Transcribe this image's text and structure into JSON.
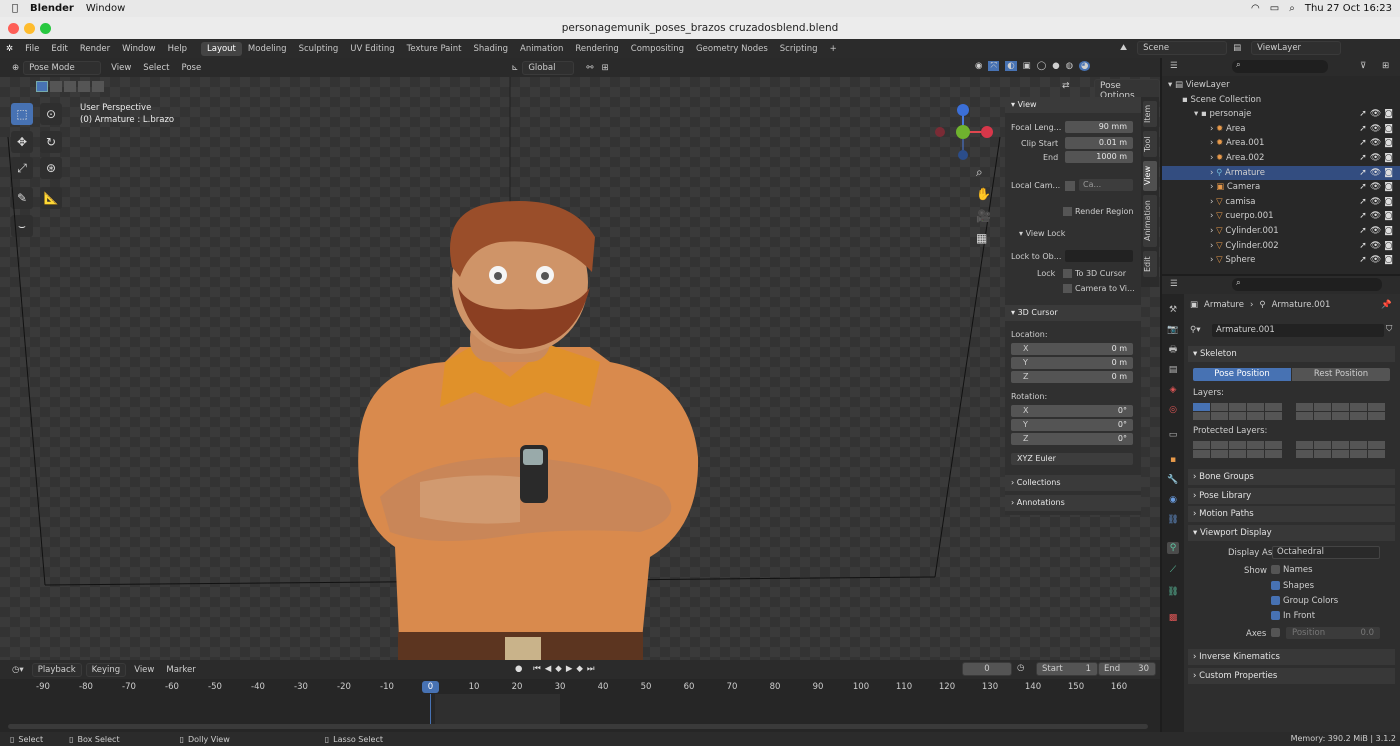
{
  "mac_menu": {
    "app": "Blender",
    "window": "Window",
    "clock": "Thu 27 Oct 16:23"
  },
  "window_title": "personagemunik_poses_brazos cruzadosblend.blend",
  "top_menu": [
    "File",
    "Edit",
    "Render",
    "Window",
    "Help"
  ],
  "workspaces": [
    "Layout",
    "Modeling",
    "Sculpting",
    "UV Editing",
    "Texture Paint",
    "Shading",
    "Animation",
    "Rendering",
    "Compositing",
    "Geometry Nodes",
    "Scripting"
  ],
  "active_workspace": "Layout",
  "scene": {
    "name": "Scene",
    "view_layer": "ViewLayer"
  },
  "viewport_header": {
    "mode": "Pose Mode",
    "menus": [
      "View",
      "Select",
      "Pose"
    ],
    "orientation": "Global",
    "pose_options": "Pose Options"
  },
  "viewport": {
    "perspective": "User Perspective",
    "active": "(0) Armature : L.brazo"
  },
  "npanel": {
    "view_title": "View",
    "focal_label": "Focal Leng...",
    "focal_value": "90 mm",
    "clip_start_label": "Clip Start",
    "clip_start_value": "0.01 m",
    "end_label": "End",
    "end_value": "1000 m",
    "local_cam_label": "Local Cam...",
    "local_cam_value": "Ca...",
    "render_region": "Render Region",
    "view_lock": "View Lock",
    "lock_obj_label": "Lock to Ob...",
    "lock_label": "Lock",
    "to_3d_cursor": "To 3D Cursor",
    "camera_to_view": "Camera to Vi...",
    "cursor_title": "3D Cursor",
    "location_label": "Location:",
    "x_label": "X",
    "y_label": "Y",
    "z_label": "Z",
    "loc_x": "0 m",
    "loc_y": "0 m",
    "loc_z": "0 m",
    "rotation_label": "Rotation:",
    "rot_x": "0°",
    "rot_y": "0°",
    "rot_z": "0°",
    "euler": "XYZ Euler",
    "collections": "Collections",
    "annotations": "Annotations"
  },
  "ntabs": [
    "Item",
    "Tool",
    "View",
    "Animation",
    "Edit"
  ],
  "outliner": {
    "rows": [
      {
        "label": "ViewLayer"
      },
      {
        "label": "Scene Collection"
      },
      {
        "label": "personaje"
      },
      {
        "label": "Area"
      },
      {
        "label": "Area.001"
      },
      {
        "label": "Area.002"
      },
      {
        "label": "Armature"
      },
      {
        "label": "Camera"
      },
      {
        "label": "camisa"
      },
      {
        "label": "cuerpo.001"
      },
      {
        "label": "Cylinder.001"
      },
      {
        "label": "Cylinder.002"
      },
      {
        "label": "Sphere"
      }
    ]
  },
  "properties": {
    "breadcrumb_obj": "Armature",
    "breadcrumb_data": "Armature.001",
    "data_name": "Armature.001",
    "skeleton": "Skeleton",
    "pose_position": "Pose Position",
    "rest_position": "Rest Position",
    "layers": "Layers:",
    "protected_layers": "Protected Layers:",
    "bone_groups": "Bone Groups",
    "pose_library": "Pose Library",
    "motion_paths": "Motion Paths",
    "viewport_display": "Viewport Display",
    "display_as_label": "Display As",
    "display_as_value": "Octahedral",
    "show_label": "Show",
    "names": "Names",
    "shapes": "Shapes",
    "group_colors": "Group Colors",
    "in_front": "In Front",
    "axes_label": "Axes",
    "position": "Position",
    "position_value": "0.0",
    "inverse_kinematics": "Inverse Kinematics",
    "custom_properties": "Custom Properties"
  },
  "timeline": {
    "menus": [
      "Playback",
      "Keying",
      "View",
      "Marker"
    ],
    "current_frame": "0",
    "start_label": "Start",
    "start": "1",
    "end_label": "End",
    "end": "30",
    "ticks": [
      "-90",
      "-80",
      "-70",
      "-60",
      "-50",
      "-40",
      "-30",
      "-20",
      "-10",
      "0",
      "10",
      "20",
      "30",
      "40",
      "50",
      "60",
      "70",
      "80",
      "90",
      "100",
      "110",
      "120",
      "130",
      "140",
      "150",
      "160"
    ]
  },
  "statusbar": {
    "select": "Select",
    "box_select": "Box Select",
    "dolly_view": "Dolly View",
    "lasso_select": "Lasso Select",
    "memory": "Memory: 390.2 MiB | 3.1.2"
  }
}
